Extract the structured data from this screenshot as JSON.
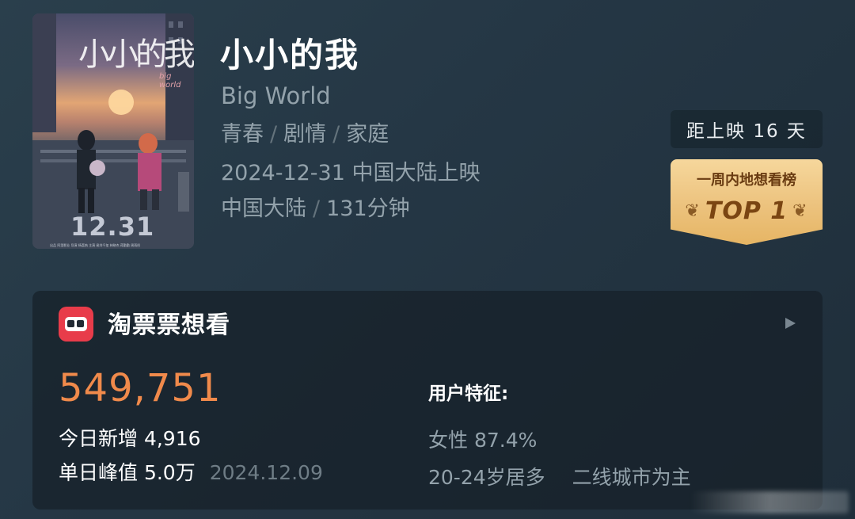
{
  "poster": {
    "title_art": "小小的我",
    "subtitle_art": "big world",
    "date_art": "12.31",
    "credits": "出品 阿里影业 导演 杨荔钠 主演 易烊千玺 林晓杰 蒋勤勤 周雨彤"
  },
  "movie": {
    "title": "小小的我",
    "english_title": "Big World",
    "genres": [
      "青春",
      "剧情",
      "家庭"
    ],
    "release": "2024-12-31 中国大陆上映",
    "region": "中国大陆",
    "duration": "131分钟",
    "separator": "/"
  },
  "countdown": {
    "text": "距上映 16 天"
  },
  "badge": {
    "label": "一周内地想看榜",
    "rank": "TOP 1"
  },
  "card": {
    "app_name": "淘票票想看",
    "want_count": "549,751",
    "today_label": "今日新增 4,916",
    "peak_label": "单日峰值 5.0万",
    "peak_date": "2024.12.09",
    "features_title": "用户特征:",
    "female": "女性 87.4%",
    "age": "20-24岁居多",
    "city": "二线城市为主"
  },
  "colors": {
    "accent_orange": "#f08a4b",
    "badge_gold": "#ecc27d",
    "app_red": "#e83c4a"
  },
  "icons": [
    "taopiaopiao-app-icon",
    "play-arrow-icon",
    "laurel-icon"
  ]
}
